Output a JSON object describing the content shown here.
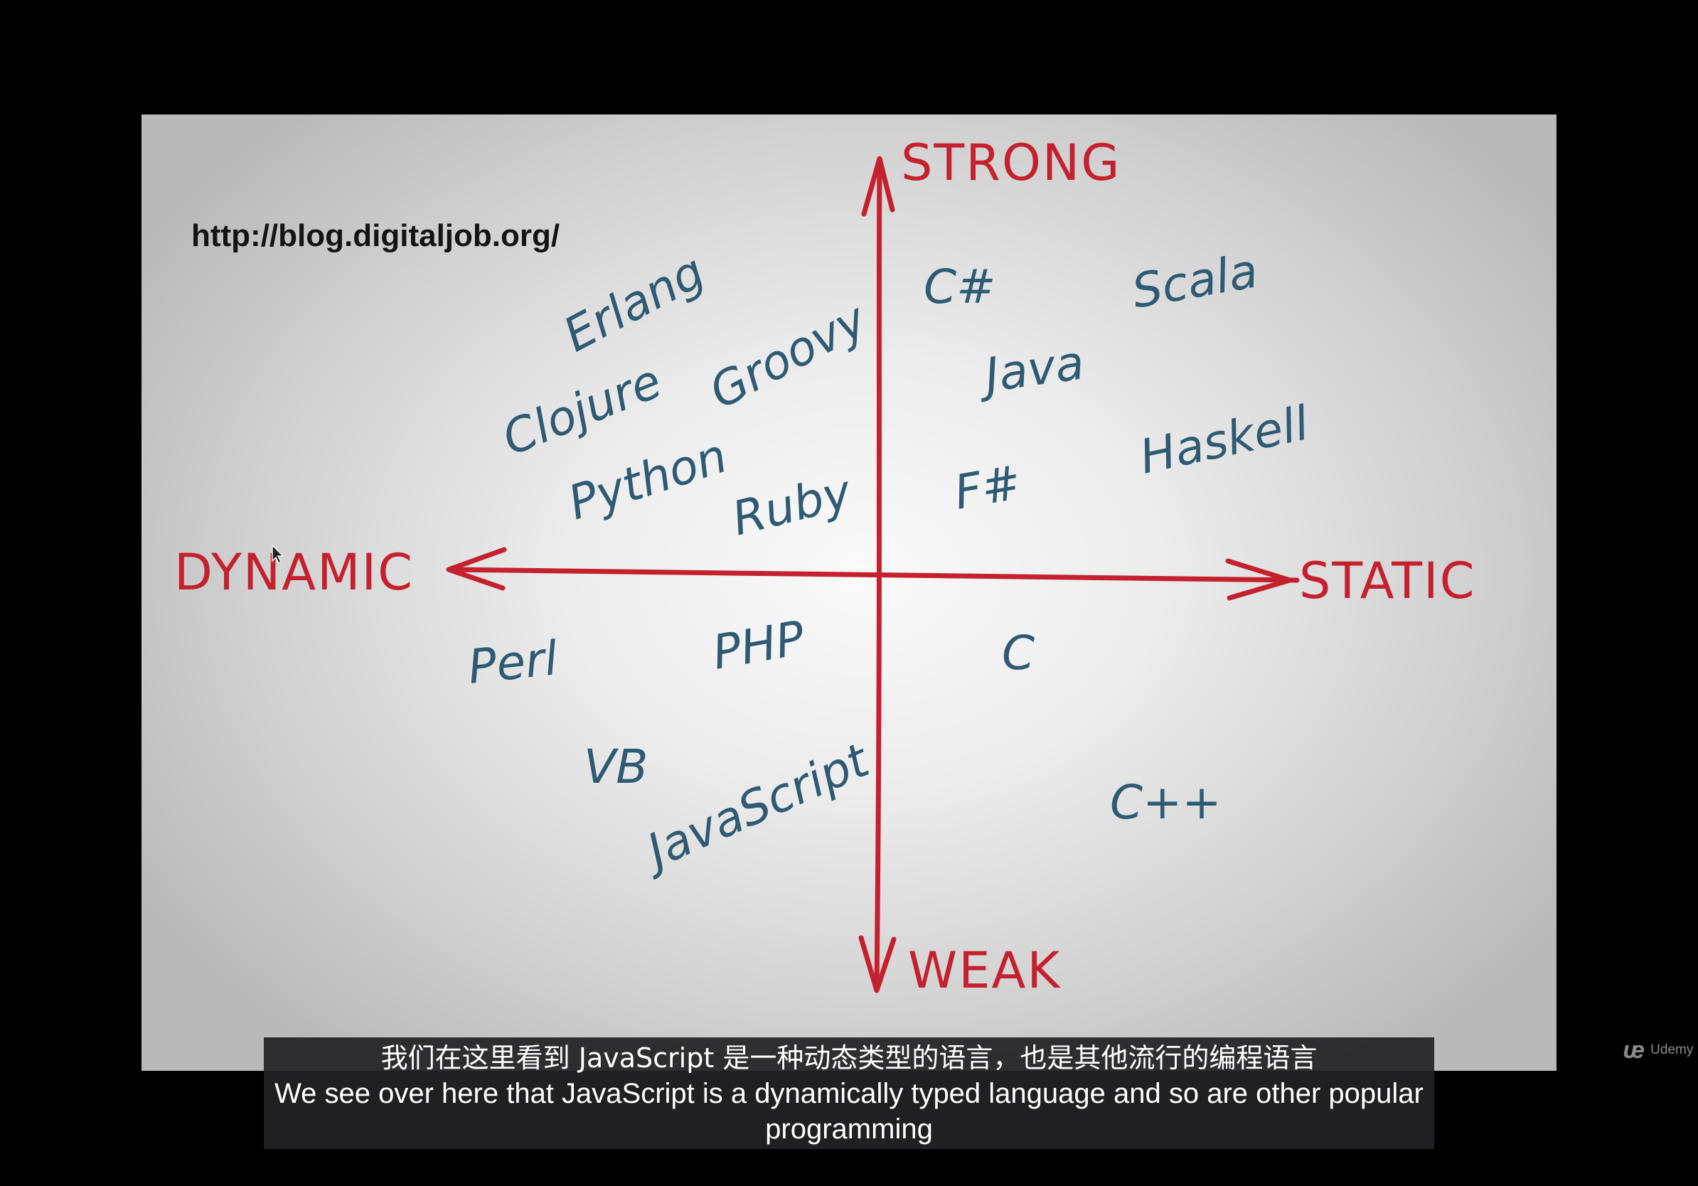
{
  "slide": {
    "source_url": "http://blog.digitaljob.org/",
    "axes": {
      "top": "STRONG",
      "bottom": "WEAK",
      "left": "DYNAMIC",
      "right": "STATIC"
    },
    "languages": {
      "dynamic_strong": [
        "Erlang",
        "Clojure",
        "Groovy",
        "Python",
        "Ruby"
      ],
      "static_strong": [
        "C#",
        "Scala",
        "Java",
        "F#",
        "Haskell"
      ],
      "dynamic_weak": [
        "Perl",
        "PHP",
        "VB",
        "JavaScript"
      ],
      "static_weak": [
        "C",
        "C++"
      ]
    },
    "colors": {
      "axis": "#c4202e",
      "language_text": "#2e5a73",
      "url_text": "#141414"
    }
  },
  "subtitles": {
    "chinese": "我们在这里看到 JavaScript 是一种动态类型的语言，也是其他流行的编程语言",
    "english": "We see over here that JavaScript is a dynamically typed language and so are other popular programming"
  },
  "watermark": {
    "brand": "Udemy",
    "icon": "udemy-logo-icon"
  }
}
